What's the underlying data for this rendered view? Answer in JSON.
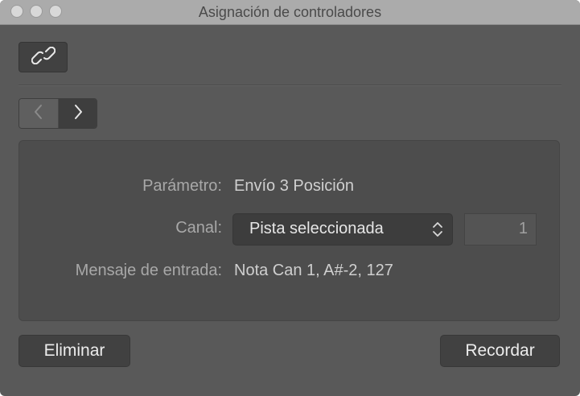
{
  "window": {
    "title": "Asignación de controladores"
  },
  "toolbar": {
    "link_icon": "link-icon"
  },
  "nav": {
    "prev_icon": "chevron-left-icon",
    "next_icon": "chevron-right-icon"
  },
  "panel": {
    "parameter_label": "Parámetro:",
    "parameter_value": "Envío 3 Posición",
    "channel_label": "Canal:",
    "channel_select_value": "Pista seleccionada",
    "channel_number": "1",
    "input_message_label": "Mensaje de entrada:",
    "input_message_value": "Nota Can 1, A#-2, 127"
  },
  "buttons": {
    "delete_label": "Eliminar",
    "learn_label": "Recordar"
  },
  "colors": {
    "window_bg": "#595959",
    "panel_bg": "#4d4d4d",
    "button_bg": "#414141",
    "titlebar_bg": "#ababab"
  }
}
